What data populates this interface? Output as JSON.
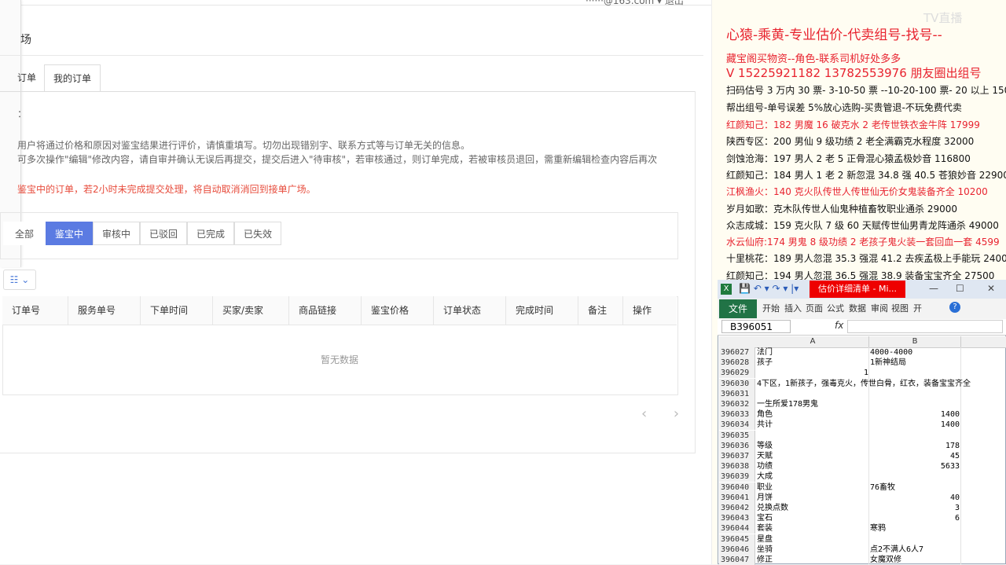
{
  "webapp": {
    "topbar_text": "······@163.com ▾  退出",
    "page_title": "场",
    "tabs": [
      "订单",
      "我的订单"
    ],
    "notice_head": "：",
    "notices": [
      "用户将通过价格和原因对鉴宝结果进行评价，请慎重填写。切勿出现错别字、联系方式等与订单无关的信息。",
      "可多次操作\"编辑\"修改内容，请自审并确认无误后再提交，提交后进入\"待审核\"，若审核通过，则订单完成，若被审核员退回，需重新编辑检查内容后再次",
      "鉴宝中的订单，若2小时未完成提交处理，将自动取消消回到接单广场。"
    ],
    "filters": [
      "全部",
      "鉴宝中",
      "审核中",
      "已驳回",
      "已完成",
      "已失效"
    ],
    "active_filter": "鉴宝中",
    "column_toggle": "☷ ⌄",
    "table_headers": [
      "订单号",
      "服务单号",
      "下单时间",
      "买家/卖家",
      "商品链接",
      "鉴宝价格",
      "订单状态",
      "完成时间",
      "备注",
      "操作"
    ],
    "empty_text": "暂无数据",
    "pager": "‹ ›"
  },
  "ad": {
    "title": "心猿-乘黄-专业估价-代卖组号-找号--",
    "watermark": "TV直播",
    "lines": [
      {
        "text": "藏宝阁买物资--角色-联系司机好处多多",
        "red": true
      },
      {
        "text": "V 15225921182   13782553976 朋友圈出组号",
        "red": true
      },
      {
        "text": "扫码估号 3 万内 30 票- 3-10-50 票  --10-20-100 票- 20 以上 150",
        "red": false
      },
      {
        "text": "帮出组号-单号误差 5%放心选购-买贵管退-不玩免费代卖",
        "red": false
      },
      {
        "text": "红颜知己：182 男魔 16 破克水 2 老传世铁衣金牛阵 17999",
        "red": true
      },
      {
        "text": "陕西专区：200 男仙 9 级功绩 2 老全满霸克水程度 32000",
        "red": false
      },
      {
        "text": "剑蚀沧海：197 男人 2 老 5 正骨混心猿孟极妙音 116800",
        "red": false
      },
      {
        "text": "红颜知己：184 男人 1 老 2 新忽混 34.8 强 40.5 苍狼妙音 22900",
        "red": false
      },
      {
        "text": "江枫渔火：140 克火队传世人传世仙无价女鬼装备齐全 10200",
        "red": true
      },
      {
        "text": "岁月如歌：克木队传世人仙鬼种植畜牧职业通杀 29000",
        "red": false
      },
      {
        "text": "众志成城：159 克火队 7 级 60 天赋传世仙男青龙阵通杀 49000",
        "red": false
      },
      {
        "text": "水云仙府:174 男鬼 8 级功绩 2 老孩子鬼火装一套回血一套 4599",
        "red": true
      },
      {
        "text": "十里桃花：189 男人忽混 35.3 强混 41.2 去疾孟极上手能玩 24000",
        "red": false
      },
      {
        "text": "红颜知己：194 男人忽混 36.5 强混 38.9 装备宝宝齐全 27500",
        "red": false
      }
    ]
  },
  "excel": {
    "logo": "X",
    "title_tab": "估价详细清单 - Mi...",
    "window_buttons": [
      "?",
      "—",
      "☐",
      "✕"
    ],
    "file_tab": "文件",
    "ribbon_tabs": [
      "开始",
      "插入",
      "页面",
      "公式",
      "数据",
      "审阅",
      "视图",
      "开"
    ],
    "name_box": "B396051",
    "fx": "fx",
    "col_headers": [
      "A",
      "B"
    ],
    "rows": [
      {
        "n": "396027",
        "a": "法门",
        "b": "4000-4000",
        "bnum": false
      },
      {
        "n": "396028",
        "a": "孩子",
        "b": "1新神结局",
        "bnum": false
      },
      {
        "n": "396029",
        "a": "1",
        "b": "",
        "anum": true
      },
      {
        "n": "396030",
        "a": "4下区，1新孩子，强毒克火，传世白骨，红衣，装备宝宝齐全",
        "b": ""
      },
      {
        "n": "396031",
        "a": "",
        "b": ""
      },
      {
        "n": "396032",
        "a": "一生所爱178男鬼",
        "b": ""
      },
      {
        "n": "396033",
        "a": "角色",
        "b": "1400",
        "bnum": true
      },
      {
        "n": "396034",
        "a": "共计",
        "b": "1400",
        "bnum": true
      },
      {
        "n": "396035",
        "a": "",
        "b": ""
      },
      {
        "n": "396036",
        "a": "等级",
        "b": "178",
        "bnum": true
      },
      {
        "n": "396037",
        "a": "天赋",
        "b": "45",
        "bnum": true
      },
      {
        "n": "396038",
        "a": "功绩",
        "b": "5633",
        "bnum": true
      },
      {
        "n": "396039",
        "a": "大成",
        "b": ""
      },
      {
        "n": "396040",
        "a": "职业",
        "b": "76畜牧",
        "bnum": false
      },
      {
        "n": "396041",
        "a": "月饼",
        "b": "40",
        "bnum": true
      },
      {
        "n": "396042",
        "a": "兑换点数",
        "b": "3",
        "bnum": true
      },
      {
        "n": "396043",
        "a": "宝石",
        "b": "6",
        "bnum": true
      },
      {
        "n": "396044",
        "a": "套装",
        "b": "寒鸦",
        "bnum": false
      },
      {
        "n": "396045",
        "a": "星盘",
        "b": ""
      },
      {
        "n": "396046",
        "a": "坐骑",
        "b": "点2不满人6人7",
        "bnum": false
      },
      {
        "n": "396047",
        "a": "修正",
        "b": "女魔双修",
        "bnum": false
      }
    ]
  }
}
